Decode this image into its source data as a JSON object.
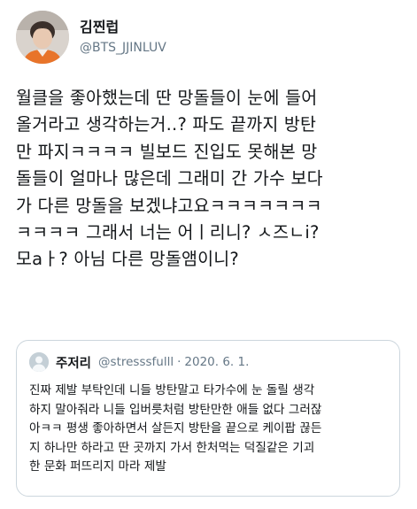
{
  "author": {
    "display_name": "김찐럽",
    "handle": "@BTS_JJINLUV",
    "avatar_icon": "profile-photo"
  },
  "tweet": {
    "lines": [
      "월클을 좋아했는데 딴 망돌들이 눈에 들어",
      "올거라고 생각하는거..? 파도 끝까지 방탄",
      "만 파지ㅋㅋㅋㅋ 빌보드 진입도 못해본 망",
      "돌들이 얼마나 많은데 그래미 간 가수 보다",
      "가 다른 망돌을 보겠냐고요ㅋㅋㅋㅋㅋㅋㅋ",
      "ㅋㅋㅋㅋ 그래서 너는 어ㅣ리니? ㅅ즈ㄴi?",
      "모aㅏ? 아님 다른 망돌앰이니?"
    ]
  },
  "quoted_tweet": {
    "display_name": "주저리",
    "handle": "@stresssfulll",
    "separator": "·",
    "date": "2020. 6. 1.",
    "avatar_icon": "default-avatar-icon",
    "lines": [
      "진짜 제발 부탁인데 니들 방탄말고 타가수에 눈 돌릴 생각",
      "하지 말아줘라 니들 입버릇처럼 방탄만한 애들 없다 그러잖",
      "아ㅋㅋ 평생 좋아하면서 살든지 방탄을 끝으로 케이팝 끊든",
      "지 하나만 하라고 딴 곳까지 가서 한처먹는 덕질같은 기괴",
      "한 문화 퍼뜨리지 마라 제발"
    ]
  },
  "colors": {
    "text_primary": "#14171a",
    "text_secondary": "#657786",
    "border": "#ccd6dd"
  }
}
